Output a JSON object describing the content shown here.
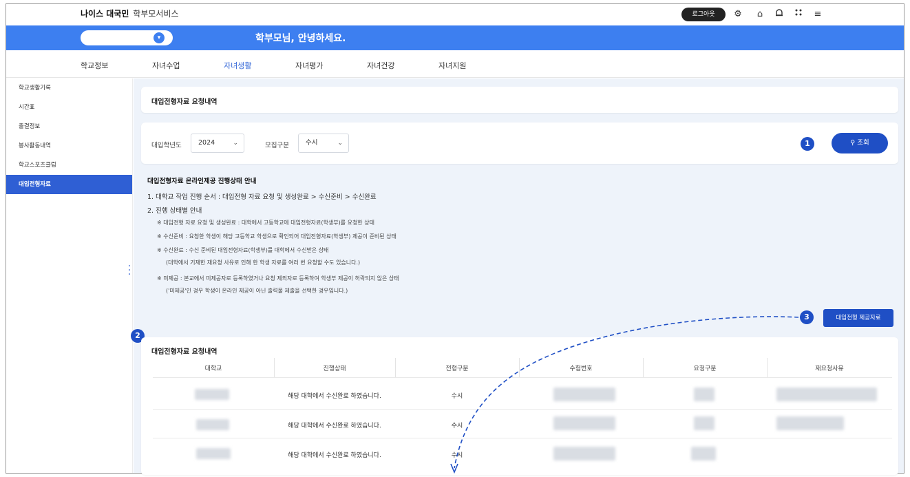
{
  "header": {
    "brand_bold": "나이스 대국민",
    "brand_rest": "학부모서비스",
    "logout_label": "로그아웃",
    "greeting": "학부모님, 안녕하세요."
  },
  "nav": {
    "tabs": [
      {
        "label": "학교정보"
      },
      {
        "label": "자녀수업"
      },
      {
        "label": "자녀생활"
      },
      {
        "label": "자녀평가"
      },
      {
        "label": "자녀건강"
      },
      {
        "label": "자녀지원"
      }
    ],
    "active_index": 2
  },
  "sidebar": {
    "items": [
      {
        "label": "학교생활기록"
      },
      {
        "label": "시간표"
      },
      {
        "label": "출결정보"
      },
      {
        "label": "봉사활동내역"
      },
      {
        "label": "학교스포츠클럽"
      },
      {
        "label": "대입전형자료"
      }
    ],
    "active_index": 5
  },
  "page": {
    "title": "대입전형자료 요청내역"
  },
  "filter": {
    "year_label": "대입학년도",
    "year_value": "2024",
    "type_label": "모집구분",
    "type_value": "수시",
    "search_label": "조회"
  },
  "badges": {
    "b1": "1",
    "b2": "2",
    "b3": "3"
  },
  "notice": {
    "title": "대입전형자료 온라인제공 진행상태 안내",
    "line1": "1. 대학교 작업 진행 순서 : 대입전형 자료 요청 및 생성완료 > 수신준비 > 수신완료",
    "line2": "2. 진행 상태별 안내",
    "sub1": "※ 대입전형 자료 요청 및 생성완료 : 대학에서 고등학교에 대입전형자료(학생부)를 요청한 상태",
    "sub2": "※ 수신준비 : 요청한 학생이 해당 고등학교 학생으로 확인되어 대입전형자료(학생부) 제공이 준비된 상태",
    "sub3": "※ 수신완료 : 수신 준비된 대입전형자료(학생부)를 대학에서 수신받은 상태",
    "sub3b": "(대학에서 기재한 재요청 사유로 인해 한 학생 자료를 여러 번 요청할 수도 있습니다.)",
    "sub4": "※ 미제공 : 본교에서 미제공자로 등록하였거나 요청 제외자로 등록하여 학생부 제공이 허락되지 않은 상태",
    "sub4b": "('미제공'인 경우 학생이 온라인 제공이 아닌 출력물 제출을 선택한 경우입니다.)"
  },
  "provide_button": "대입전형 제공자료",
  "table": {
    "title": "대입전형자료 요청내역",
    "headers": [
      "대학교",
      "진행상태",
      "전형구분",
      "수험번호",
      "요청구분",
      "재요청사유"
    ],
    "rows": [
      {
        "status": "해당 대학에서 수신완료 하였습니다.",
        "type": "수시"
      },
      {
        "status": "해당 대학에서 수신완료 하였습니다.",
        "type": "수시"
      },
      {
        "status": "해당 대학에서 수신완료 하였습니다.",
        "type": "수시"
      }
    ]
  },
  "icons": [
    "settings-icon",
    "home-icon",
    "bell-icon",
    "apps-icon",
    "menu-icon",
    "chevron-down-icon",
    "search-icon"
  ],
  "colors": {
    "brand_blue": "#3d7ff0",
    "button_blue": "#1f4fc5",
    "active_nav": "#2e63d6",
    "panel_bg": "#eef3fa"
  }
}
